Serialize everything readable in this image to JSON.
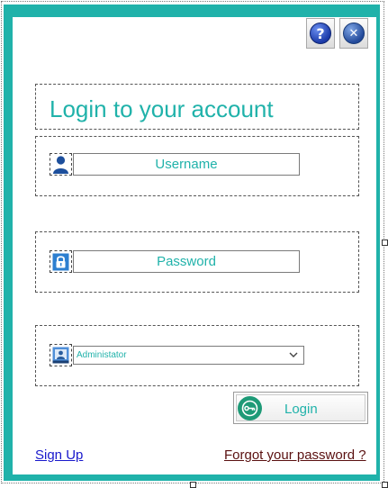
{
  "login": {
    "title": "Login to your account",
    "username_placeholder": "Username",
    "password_placeholder": "Password",
    "role_selected": "Administator",
    "login_label": "Login",
    "signup_label": "Sign Up",
    "forgot_label": "Forgot your password ?"
  },
  "icons": {
    "help": "help-icon",
    "close": "close-icon",
    "user": "user-icon",
    "lock": "lock-icon",
    "role": "id-card-icon",
    "key": "key-icon",
    "dropdown": "chevron-down-icon"
  },
  "colors": {
    "accent": "#20b2aa",
    "login_icon": "#1e9a77",
    "signup_link": "#1818cc",
    "forgot_link": "#5a1010"
  }
}
